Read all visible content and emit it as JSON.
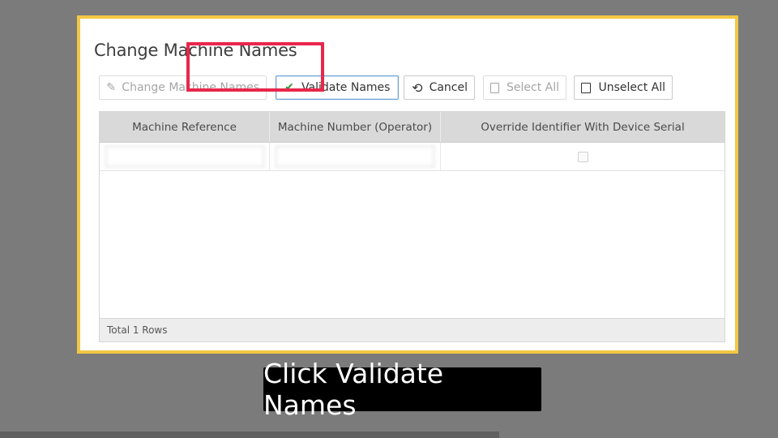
{
  "dialog": {
    "title": "Change Machine Names",
    "toolbar": {
      "change_names": "Change Machine Names",
      "validate": "Validate Names",
      "cancel": "Cancel",
      "select_all": "Select All",
      "unselect_all": "Unselect All"
    },
    "grid": {
      "columns": [
        "Machine Reference",
        "Machine Number (Operator)",
        "Override Identifier With Device Serial"
      ],
      "rows": [
        {
          "reference": "",
          "number": "",
          "override": false
        }
      ],
      "footer": "Total 1 Rows"
    }
  },
  "caption": "Click Validate Names",
  "colors": {
    "accent_border": "#f2c744",
    "highlight": "#e8274b",
    "check": "#2f8f2f"
  },
  "icons": [
    "pencil-icon",
    "checkmark-icon",
    "undo-icon",
    "checkbox-checked-icon",
    "checkbox-empty-icon"
  ]
}
